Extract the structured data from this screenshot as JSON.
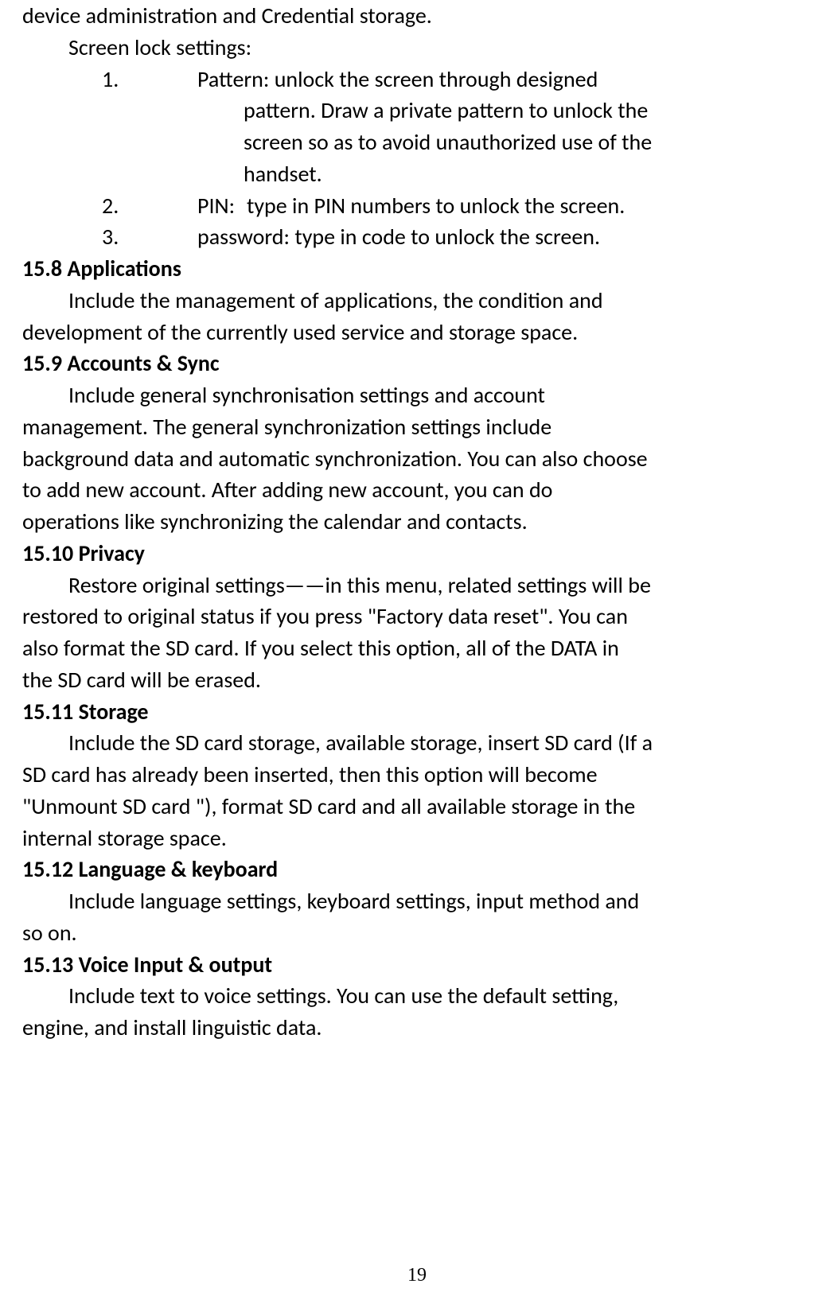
{
  "intro_line1": "device administration and Credential storage.",
  "screen_lock_label": "Screen lock settings:",
  "item1_num": "1.",
  "item1_line1": "Pattern: unlock the screen through designed",
  "item1_line2": "pattern. Draw a private pattern to unlock the",
  "item1_line3": "screen so as to avoid unauthorized use of the",
  "item1_line4": "handset.",
  "item2_num": "2.",
  "item2_label": "PIN:",
  "item2_text": "type in PIN numbers to unlock the screen.",
  "item3_num": "3.",
  "item3_text": "password: type in code to unlock the screen.",
  "h_15_8": "15.8 Applications",
  "p_15_8_l1": "Include the management of applications, the condition and",
  "p_15_8_l2": "development of the currently used service and storage space.",
  "h_15_9": "15.9 Accounts & Sync",
  "p_15_9_l1": "Include general synchronisation settings and account",
  "p_15_9_l2": "management. The general synchronization settings include",
  "p_15_9_l3": "background data and automatic synchronization. You can also choose",
  "p_15_9_l4": "to add new account. After adding new account, you can do",
  "p_15_9_l5": "operations like synchronizing the calendar and contacts.",
  "h_15_10": "15.10 Privacy",
  "p_15_10_l1": "Restore original settings——in this menu, related settings will be",
  "p_15_10_l2": "restored to original status if you press \"Factory data reset\". You can",
  "p_15_10_l3": "also format the SD card. If you select this option, all of the DATA in",
  "p_15_10_l4": "the SD card will be erased.",
  "h_15_11": "15.11 Storage",
  "p_15_11_l1": "Include the SD card storage, available storage, insert SD card (If a",
  "p_15_11_l2": "SD card has already been inserted, then this option will become",
  "p_15_11_l3": "\"Unmount SD card \"), format SD card and all available storage in the",
  "p_15_11_l4": "internal storage space.",
  "h_15_12": "15.12 Language & keyboard",
  "p_15_12_l1": "Include language settings, keyboard settings, input method and",
  "p_15_12_l2": "so on.",
  "h_15_13": "15.13 Voice Input & output",
  "p_15_13_l1": "Include text to voice settings. You can use the default setting,",
  "p_15_13_l2": "engine, and install linguistic data.",
  "page_number": "19"
}
